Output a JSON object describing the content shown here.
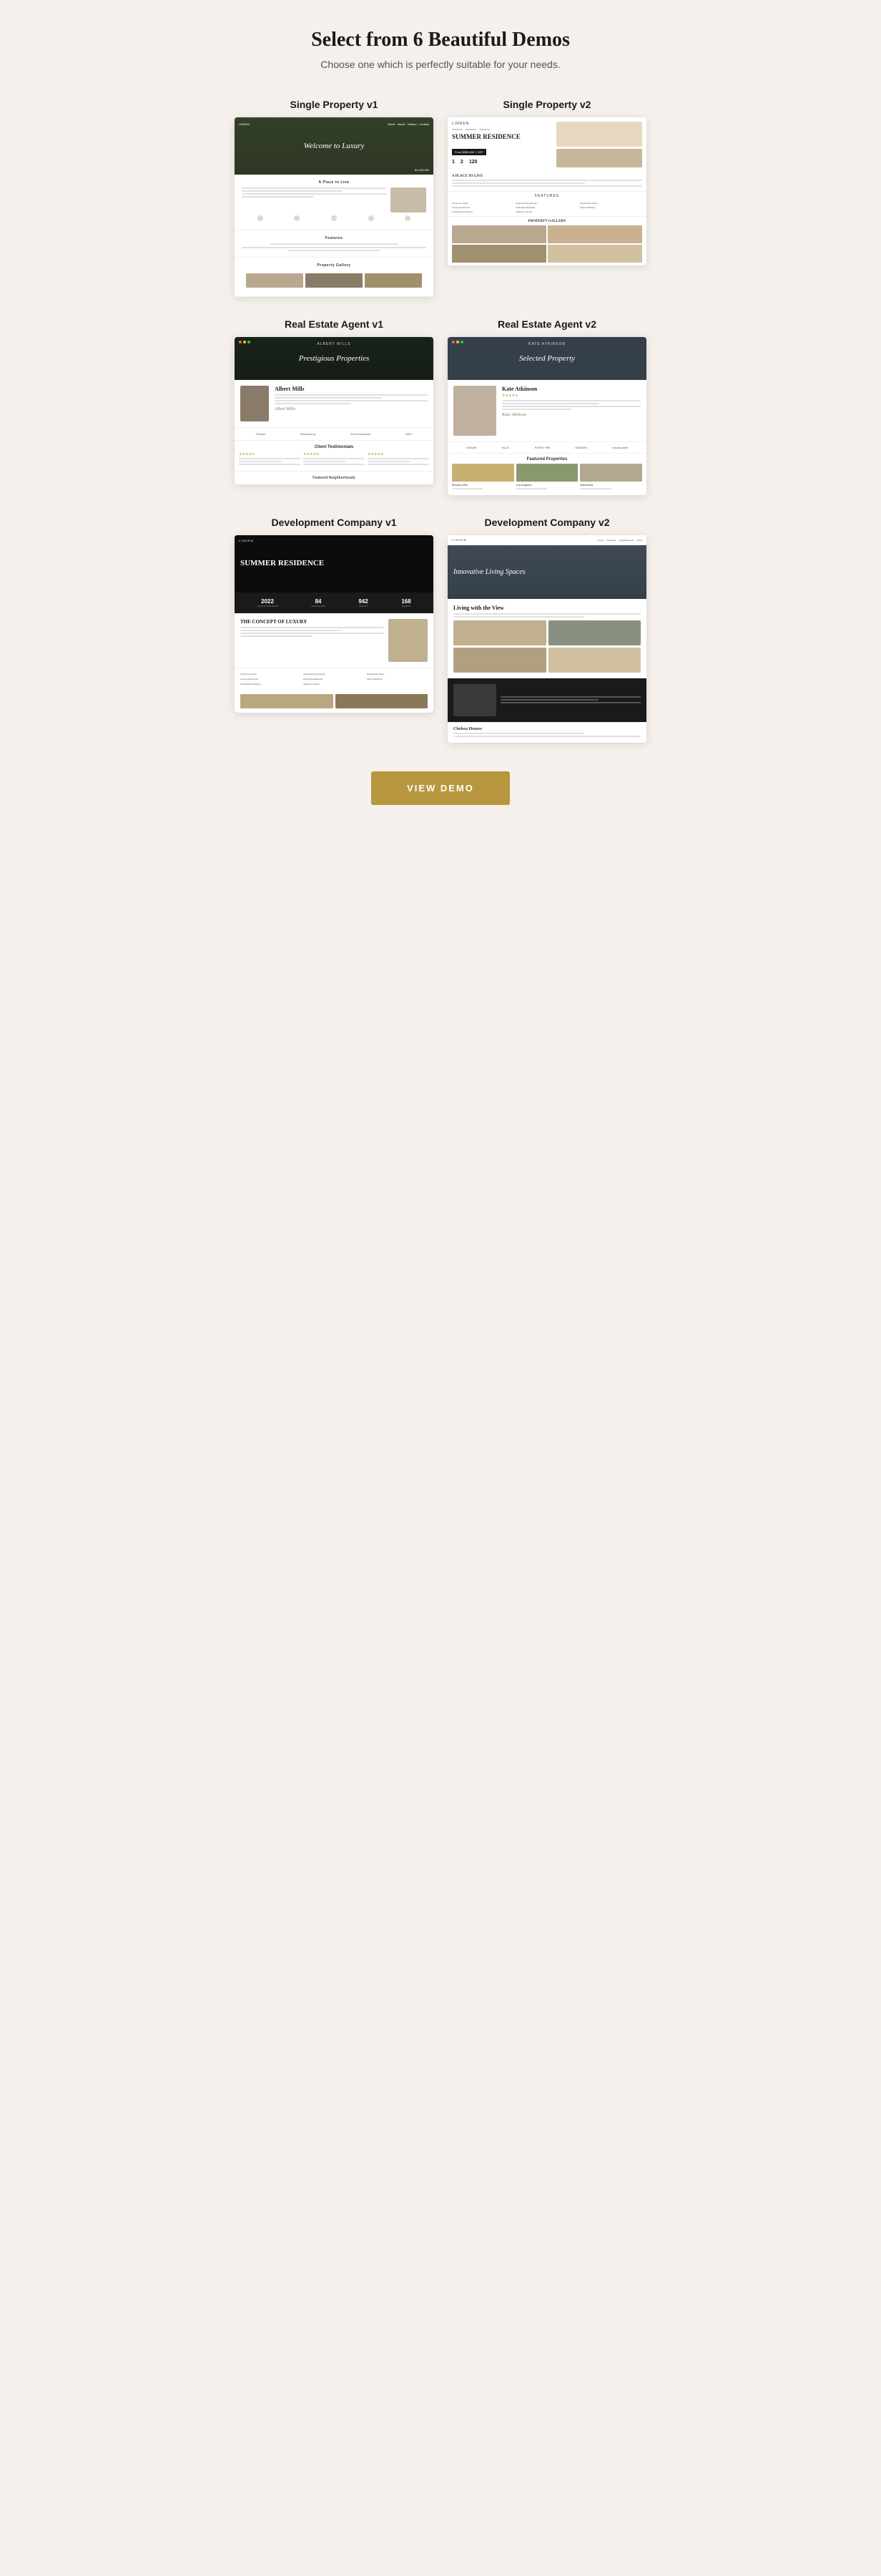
{
  "page": {
    "title": "Select from 6 Beautiful Demos",
    "subtitle": "Choose one which is perfectly suitable for your needs."
  },
  "demos": [
    {
      "id": "sp1",
      "label": "Single Property v1",
      "hero_title": "Welcome to Luxury",
      "hero_price": "$1,000,000",
      "hero_logo": "LINDEN",
      "section1_title": "A Place to Live",
      "features_title": "Features",
      "gallery_title": "Property Gallery"
    },
    {
      "id": "sp2",
      "label": "Single Property v2",
      "hero_title": "SUMMER RESIDENCE",
      "hero_logo": "LINDEN",
      "stats": [
        "1",
        "2",
        "120"
      ],
      "section1_title": "A PLACE TO LIVE",
      "features_title": "FEATURES",
      "gallery_title": "PROPERTY GALLERY"
    },
    {
      "id": "rea1",
      "label": "Real Estate Agent v1",
      "hero_title": "Prestigious Properties",
      "hero_logo": "ALBERT MILLS",
      "agent_name": "Albert Mills",
      "agent_sig": "Albert Mills",
      "logos": [
        "Forbes",
        "Bloomberg",
        "The Economist",
        "WSJ"
      ],
      "testimonials_title": "Client Testimonials",
      "neighborhoods_title": "Featured Neighborhoods"
    },
    {
      "id": "rea2",
      "label": "Real Estate Agent v2",
      "hero_title": "Selected Property",
      "hero_logo": "KATE ATKINSON",
      "agent_name": "Kate Atkinson",
      "agent_sig": "Kate Atkinson",
      "logos": [
        "VOGUE",
        "ELLE",
        "FORTY FIB",
        "DEZEEN",
        "media.slate"
      ],
      "featured_title": "Featured Properties",
      "props": [
        "Beverly Hills",
        "Los Angeles",
        "Barcelona"
      ]
    },
    {
      "id": "dc1",
      "label": "Development Company v1",
      "hero_title": "SUMMER RESIDENCE",
      "hero_logo": "LINDEN",
      "stats": [
        {
          "num": "2022",
          "label": "YEAR ESTABLISHED"
        },
        {
          "num": "84",
          "label": "PROPERTIES"
        },
        {
          "num": "942",
          "label": "CLIENTS"
        },
        {
          "num": "168",
          "label": "AWARDS"
        }
      ],
      "concept_title": "THE CONCEPT OF LUXURY"
    },
    {
      "id": "dc2",
      "label": "Development Company v2",
      "hero_title": "Innovative Living Spaces",
      "logo": "LINDEN",
      "living_title": "Living with the View",
      "chelsea_title": "Chelsea Houses"
    }
  ],
  "view_demo_btn": "VIEW DEMO"
}
